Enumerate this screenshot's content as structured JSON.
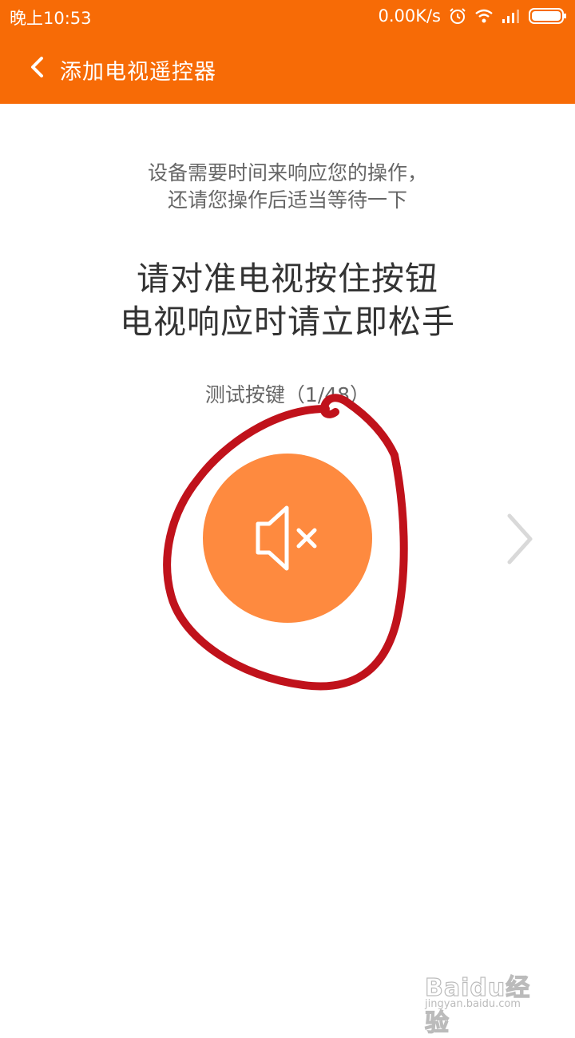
{
  "status_bar": {
    "time": "晚上10:53",
    "network_speed": "0.00K/s",
    "icons": [
      "alarm-icon",
      "wifi-icon",
      "signal-icon",
      "battery-icon"
    ]
  },
  "header": {
    "back_icon": "chevron-left-icon",
    "title": "添加电视遥控器"
  },
  "main": {
    "hint_lines": [
      "设备需要时间来响应您的操作，",
      "还请您操作后适当等待一下"
    ],
    "instruction_lines": [
      "请对准电视按住按钮",
      "电视响应时请立即松手"
    ],
    "test_key_label": "测试按键（1/48）",
    "test_key_icon": "mute-icon",
    "next_icon": "chevron-right-icon"
  },
  "watermark": {
    "brand": "Baidu经验",
    "url": "jingyan.baidu.com"
  },
  "colors": {
    "accent": "#f76b06",
    "button": "#fe8a3f",
    "markup": "#c0121b"
  }
}
